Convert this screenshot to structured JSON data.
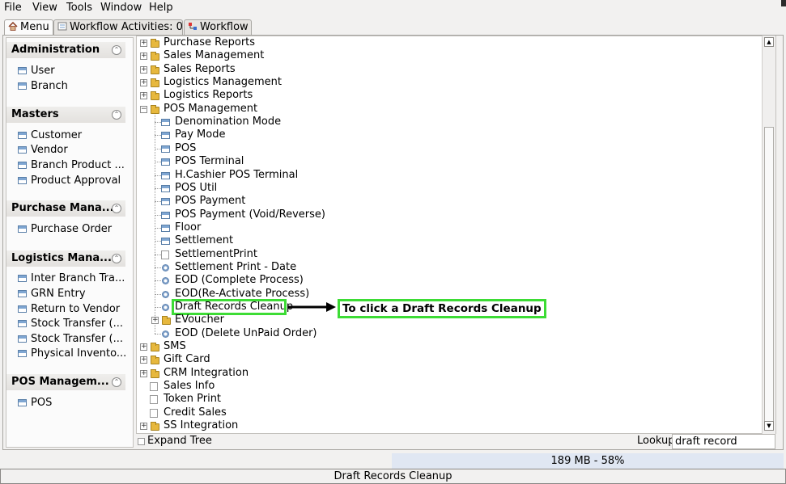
{
  "menubar": {
    "items": [
      "File",
      "View",
      "Tools",
      "Window",
      "Help"
    ]
  },
  "tabs": [
    {
      "label": "Menu",
      "icon": "home-icon"
    },
    {
      "label": "Workflow Activities: 0",
      "icon": "list-icon"
    },
    {
      "label": "Workflow",
      "icon": "workflow-icon"
    }
  ],
  "sidebar": {
    "sections": [
      {
        "title": "Administration",
        "items": [
          "User",
          "Branch"
        ]
      },
      {
        "title": "Masters",
        "items": [
          "Customer",
          "Vendor",
          "Branch Product ...",
          "Product Approval"
        ]
      },
      {
        "title": "Purchase Mana...",
        "items": [
          "Purchase Order"
        ]
      },
      {
        "title": "Logistics Mana...",
        "items": [
          "Inter Branch Tra...",
          "GRN Entry",
          "Return to Vendor",
          "Stock Transfer (...",
          "Stock Transfer (...",
          "Physical Invento..."
        ]
      },
      {
        "title": "POS Managem...",
        "items": [
          "POS"
        ]
      }
    ]
  },
  "tree": {
    "rows": [
      {
        "label": "Purchase Reports",
        "type": "folder",
        "level": 0
      },
      {
        "label": "Sales Management",
        "type": "folder",
        "level": 0
      },
      {
        "label": "Sales Reports",
        "type": "folder",
        "level": 0
      },
      {
        "label": "Logistics Management",
        "type": "folder",
        "level": 0
      },
      {
        "label": "Logistics Reports",
        "type": "folder",
        "level": 0
      },
      {
        "label": "POS Management",
        "type": "folder-open",
        "level": 0
      },
      {
        "label": "Denomination Mode",
        "type": "window",
        "level": 1
      },
      {
        "label": "Pay Mode",
        "type": "window",
        "level": 1
      },
      {
        "label": "POS",
        "type": "window",
        "level": 1
      },
      {
        "label": "POS Terminal",
        "type": "window",
        "level": 1
      },
      {
        "label": "H.Cashier POS Terminal",
        "type": "window",
        "level": 1
      },
      {
        "label": "POS Util",
        "type": "window",
        "level": 1
      },
      {
        "label": "POS Payment",
        "type": "window",
        "level": 1
      },
      {
        "label": "POS Payment (Void/Reverse)",
        "type": "window",
        "level": 1
      },
      {
        "label": "Floor",
        "type": "window",
        "level": 1
      },
      {
        "label": "Settlement",
        "type": "window",
        "level": 1
      },
      {
        "label": "SettlementPrint",
        "type": "report",
        "level": 1
      },
      {
        "label": "Settlement Print - Date",
        "type": "process",
        "level": 1
      },
      {
        "label": "EOD (Complete Process)",
        "type": "process",
        "level": 1
      },
      {
        "label": "EOD(Re-Activate Process)",
        "type": "process",
        "level": 1
      },
      {
        "label": "Draft Records Cleanup",
        "type": "process",
        "level": 1,
        "highlighted": true
      },
      {
        "label": "EVoucher",
        "type": "folder",
        "level": 1
      },
      {
        "label": "EOD (Delete UnPaid Order)",
        "type": "process",
        "level": 1
      },
      {
        "label": "SMS",
        "type": "folder",
        "level": 0
      },
      {
        "label": "Gift Card",
        "type": "folder",
        "level": 0
      },
      {
        "label": "CRM Integration",
        "type": "folder",
        "level": 0
      },
      {
        "label": "Sales Info",
        "type": "report",
        "level": 0
      },
      {
        "label": "Token Print",
        "type": "report",
        "level": 0
      },
      {
        "label": "Credit Sales",
        "type": "report",
        "level": 0
      },
      {
        "label": "SS Integration",
        "type": "folder",
        "level": 0
      }
    ]
  },
  "annotation": {
    "text": "To click a Draft Records Cleanup"
  },
  "bottom": {
    "expand_tree_label": "Expand Tree",
    "lookup_label": "Lookup",
    "lookup_value": "draft record"
  },
  "status": {
    "memory": "189 MB - 58%",
    "message": "Draft Records Cleanup"
  },
  "colors": {
    "highlight": "#3ddc35",
    "folder": "#e7b83d"
  }
}
